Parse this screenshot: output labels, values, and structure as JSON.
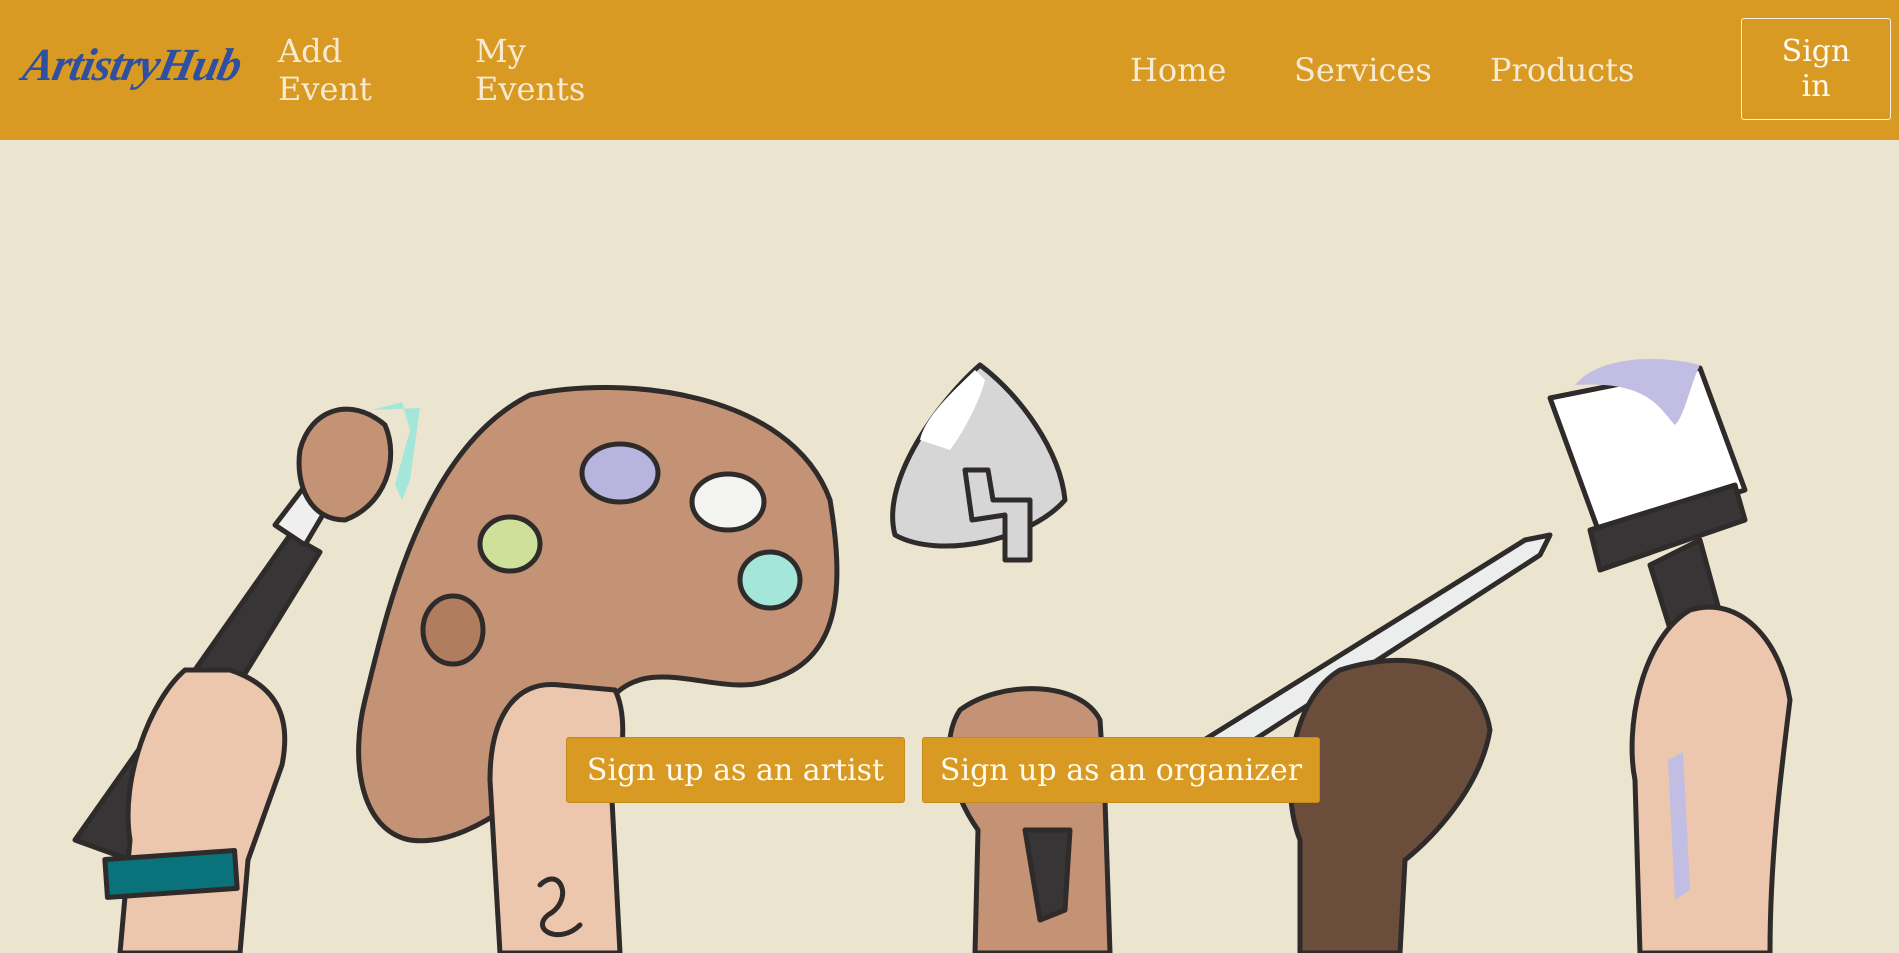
{
  "brand": {
    "name": "ArtistryHub",
    "color": "#2f4fa0"
  },
  "nav": {
    "left": [
      {
        "line1": "Add",
        "line2": "Event"
      },
      {
        "line1": "My",
        "line2": "Events"
      }
    ],
    "right": [
      "Home",
      "Services",
      "Products"
    ],
    "signin_line1": "Sign",
    "signin_line2": "in"
  },
  "hero": {
    "cta_artist": "Sign up as an artist",
    "cta_organizer": "Sign up as an organizer",
    "illustration": "hands-holding-art-tools"
  },
  "colors": {
    "nav_bg": "#d89a22",
    "page_bg": "#ebe4cf",
    "nav_text": "#f6ead2"
  }
}
